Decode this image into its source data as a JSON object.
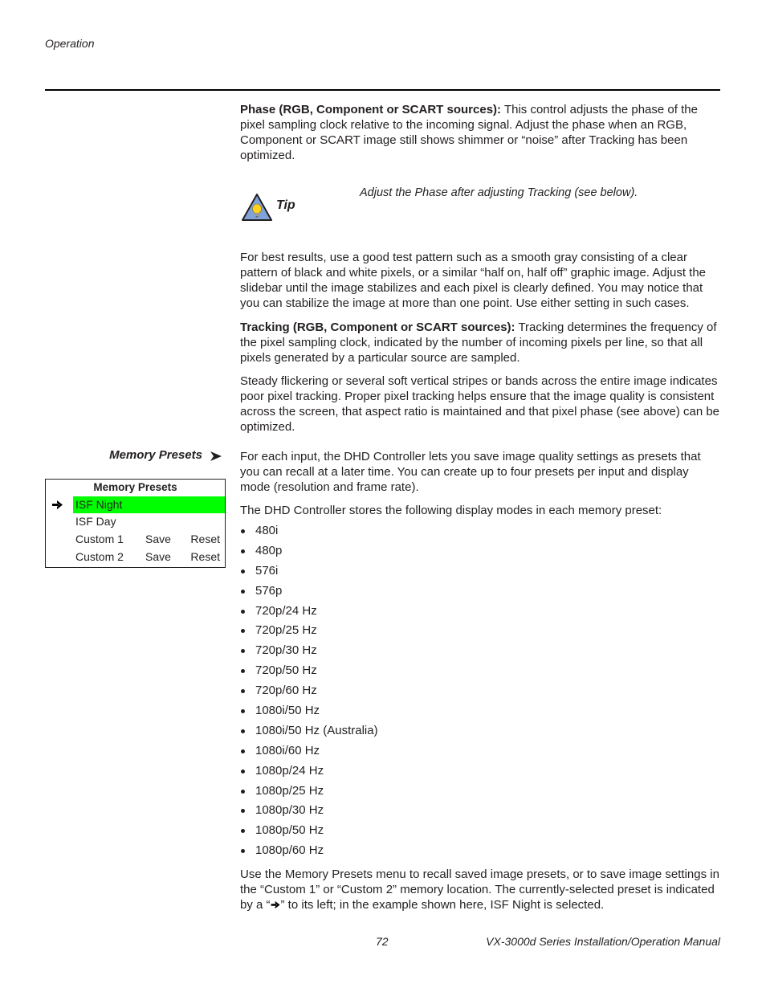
{
  "header": {
    "section": "Operation"
  },
  "phase": {
    "heading": "Phase (RGB, Component or SCART sources):",
    "text": " This control adjusts the phase of the pixel sampling clock relative to the incoming signal. Adjust the phase when an RGB, Component or SCART image still shows shimmer or “noise” after Tracking has been optimized."
  },
  "tip": {
    "icon": "lightbulb-warning-triangle-icon",
    "label": "Tip",
    "text": "Adjust the Phase after adjusting Tracking (see below)."
  },
  "best_results": "For best results, use a good test pattern such as a smooth gray consisting of a clear pattern of black and white pixels, or a similar “half on, half off” graphic image. Adjust the slidebar until the image stabilizes and each pixel is clearly defined. You may notice that you can stabilize the image at more than one point. Use either setting in such cases.",
  "tracking": {
    "heading": "Tracking (RGB, Component or SCART sources):",
    "text": " Tracking determines the frequency of the pixel sampling clock, indicated by the number of incoming pixels per line, so that all pixels generated by a particular source are sampled.",
    "text2": "Steady flickering or several soft vertical stripes or bands across the entire image indicates poor pixel tracking. Proper pixel tracking helps ensure that the image quality is consistent across the screen, that aspect ratio is maintained and that pixel phase (see above) can be optimized."
  },
  "memory_presets": {
    "side_heading": "Memory Presets",
    "intro": "For each input, the DHD Controller lets you save image quality settings as presets that you can recall at a later time. You can create up to four presets per input and display mode (resolution and frame rate).",
    "modes_intro": "The DHD Controller stores the following display modes in each memory preset:",
    "modes": [
      "480i",
      "480p",
      "576i",
      "576p",
      "720p/24 Hz",
      "720p/25 Hz",
      "720p/30 Hz",
      "720p/50 Hz",
      "720p/60 Hz",
      "1080i/50 Hz",
      "1080i/50 Hz (Australia)",
      "1080i/60 Hz",
      "1080p/24 Hz",
      "1080p/25 Hz",
      "1080p/30 Hz",
      "1080p/50 Hz",
      "1080p/60 Hz"
    ],
    "usage_part1": "Use the Memory Presets menu to recall saved image presets, or to save image settings in the “Custom 1” or “Custom 2” memory location. The currently-selected preset is indicated by a “",
    "usage_part2": "” to its left; in the example shown here, ISF Night is selected.",
    "menu": {
      "title": "Memory Presets",
      "highlight_color": "#00ff00",
      "rows": [
        {
          "label": "ISF Night",
          "selected": true
        },
        {
          "label": "ISF Day"
        },
        {
          "label": "Custom 1",
          "save": "Save",
          "reset": "Reset"
        },
        {
          "label": "Custom 2",
          "save": "Save",
          "reset": "Reset"
        }
      ]
    }
  },
  "footer": {
    "page_number": "72",
    "manual_title": "VX-3000d Series Installation/Operation Manual"
  }
}
